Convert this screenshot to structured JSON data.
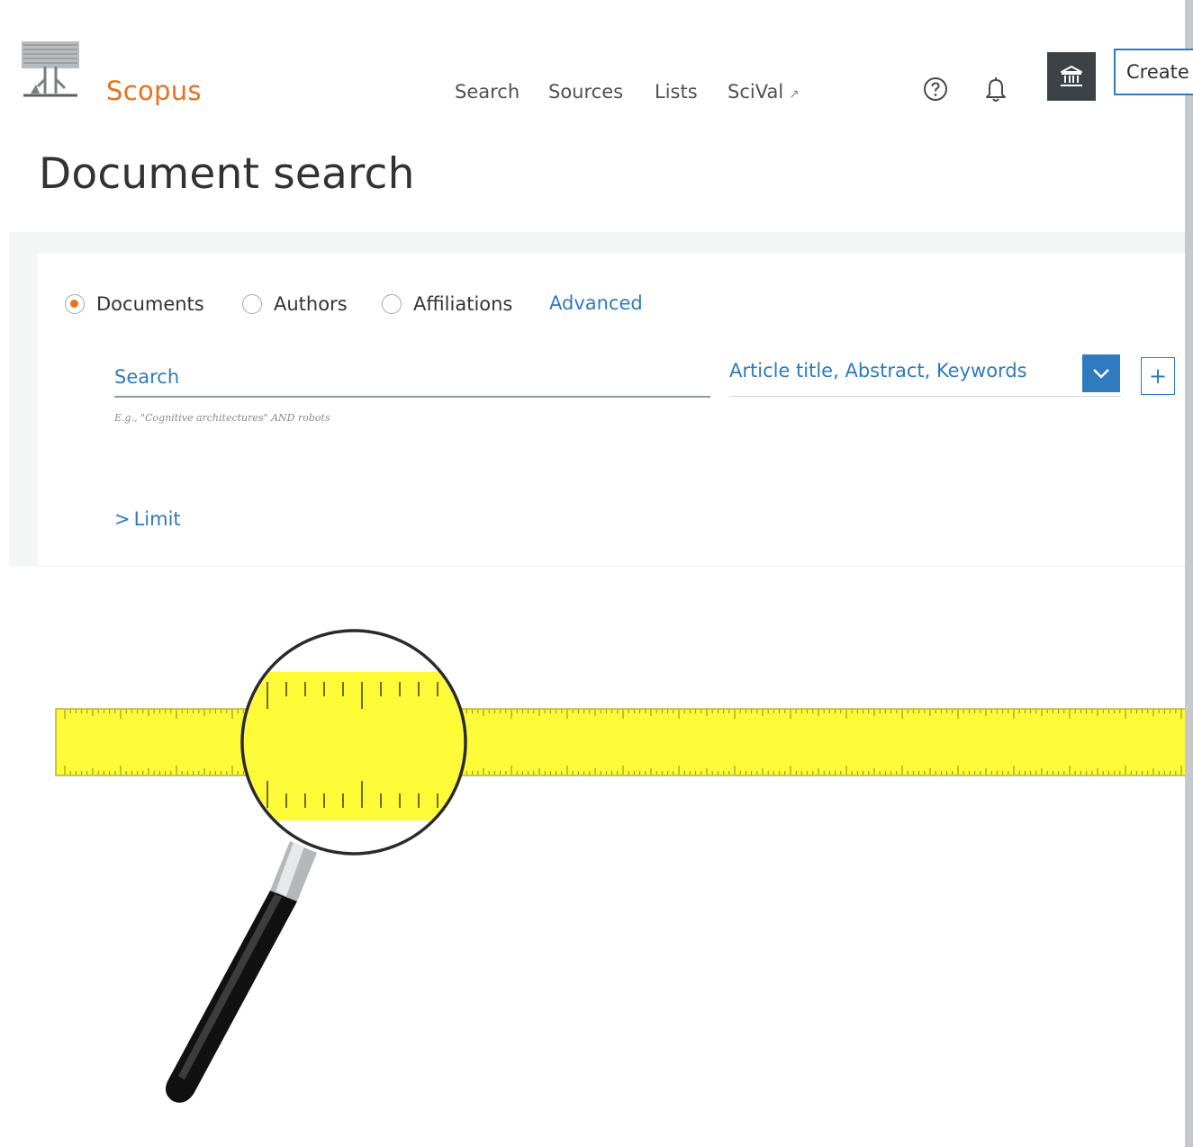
{
  "header": {
    "brand": "Scopus",
    "nav": {
      "search": "Search",
      "sources": "Sources",
      "lists": "Lists",
      "scival": "SciVal",
      "scival_arrow": "↗"
    },
    "create_label": "Create"
  },
  "page_title": "Document search",
  "search_panel": {
    "tabs": [
      {
        "label": "Documents",
        "selected": true
      },
      {
        "label": "Authors",
        "selected": false
      },
      {
        "label": "Affiliations",
        "selected": false
      }
    ],
    "advanced_label": "Advanced",
    "search_placeholder": "Search",
    "hint": "E.g., \"Cognitive architectures\" AND robots",
    "field_value": "Article title, Abstract, Keywords",
    "add_field_symbol": "+",
    "limit_label": "Limit",
    "limit_caret": ">"
  },
  "icons": {
    "help": "help-circle-icon",
    "notifications": "bell-icon",
    "institution": "institution-icon",
    "chevron": "chevron-down-icon",
    "illustration": "magnifier-over-ruler"
  },
  "colors": {
    "brand": "#e9711c",
    "link": "#2e7bbf",
    "institution_bg": "#3d4247",
    "ruler": "#fdfb38"
  }
}
